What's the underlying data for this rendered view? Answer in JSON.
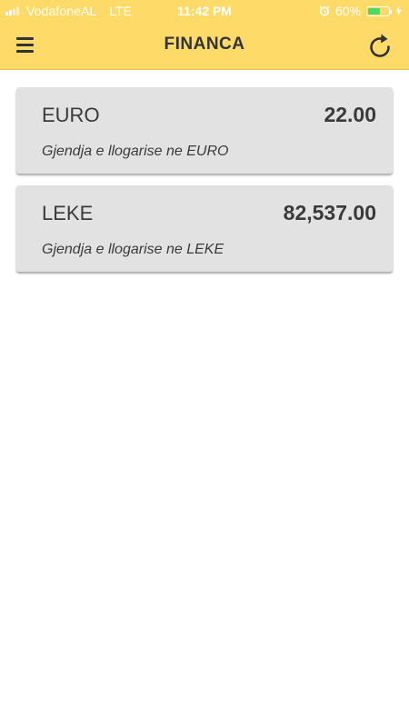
{
  "status_bar": {
    "carrier": "VodafoneAL",
    "network": "LTE",
    "time": "11:42 PM",
    "battery_percent": "60%",
    "battery_level": 0.6,
    "icons": [
      "signal-icon",
      "alarm-icon",
      "battery-icon",
      "charging-icon"
    ]
  },
  "app_bar": {
    "title": "FINANCA",
    "menu_icon": "menu-icon",
    "refresh_icon": "refresh-icon",
    "background_color": "#fedb68"
  },
  "accounts": [
    {
      "currency": "EURO",
      "amount": "22.00",
      "description": "Gjendja e llogarise ne EURO"
    },
    {
      "currency": "LEKE",
      "amount": "82,537.00",
      "description": "Gjendja e llogarise ne LEKE"
    }
  ],
  "colors": {
    "accent": "#fedb68",
    "card_background": "#e2e2e2",
    "text": "#3a3a3a",
    "battery_fill": "#4cd964"
  }
}
